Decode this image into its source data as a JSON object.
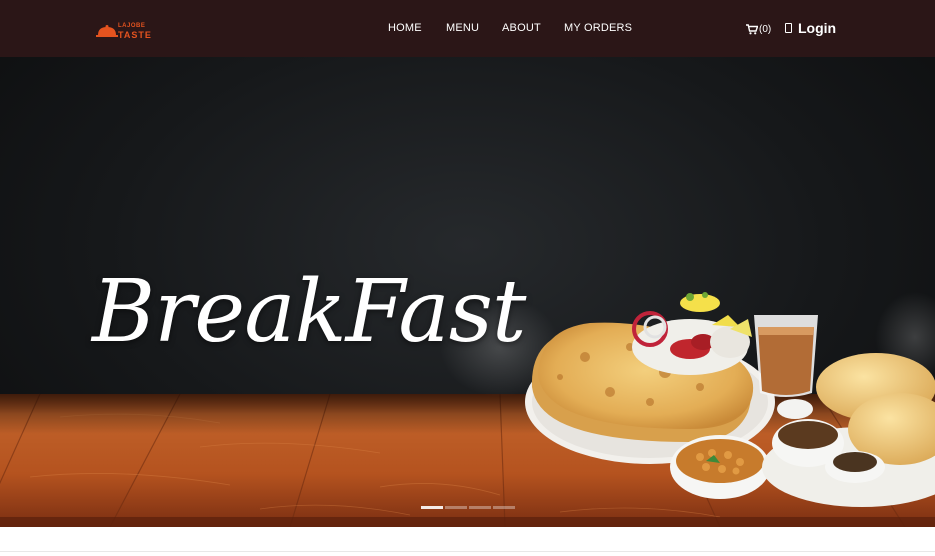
{
  "brand": {
    "name_top": "LAJOBE",
    "name_main": "TASTE",
    "accent_color": "#e5531f"
  },
  "nav": {
    "links": [
      "HOME",
      "MENU",
      "ABOUT",
      "MY ORDERS"
    ],
    "cart_count": "(0)",
    "login_label": "Login"
  },
  "hero": {
    "title": "BreakFast",
    "slide_count": 4,
    "active_slide": 1
  },
  "colors": {
    "navbar_bg": "#2b1617",
    "hero_bg": "#16181a",
    "wood": "#b5531f"
  },
  "icons": [
    "chef-cloche-logo-icon",
    "cart-icon",
    "user-icon"
  ]
}
